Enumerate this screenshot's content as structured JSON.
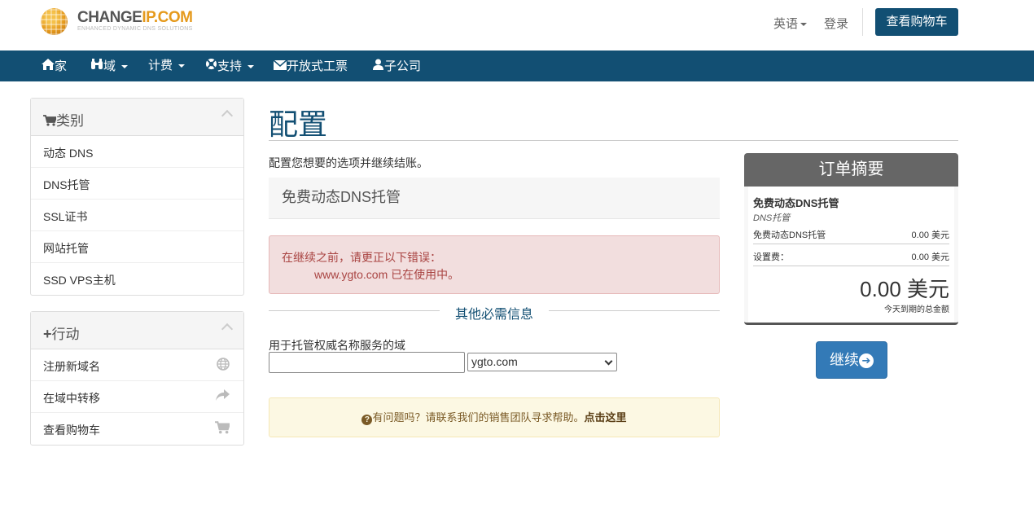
{
  "header": {
    "logo_main": "CHANGE",
    "logo_accent": "IP.COM",
    "logo_tagline": "ENHANCED DYNAMIC DNS SOLUTIONS",
    "language_label": "英语",
    "login_label": "登录",
    "cart_button": "查看购物车"
  },
  "nav": {
    "items": [
      {
        "label": "家",
        "icon": "home-icon"
      },
      {
        "label": "域",
        "icon": "binoculars-icon"
      },
      {
        "label": "计费",
        "icon": ""
      },
      {
        "label": "支持",
        "icon": "lifebuoy-icon"
      },
      {
        "label": "开放式工票",
        "icon": "envelope-icon"
      },
      {
        "label": "子公司",
        "icon": "user-icon"
      }
    ]
  },
  "sidebar": {
    "categories": {
      "title": "类别",
      "items": [
        "动态 DNS",
        "DNS托管",
        "SSL证书",
        "网站托管",
        "SSD VPS主机"
      ]
    },
    "actions": {
      "title": "行动",
      "items": [
        {
          "label": "注册新域名",
          "icon": "globe-icon"
        },
        {
          "label": "在域中转移",
          "icon": "share-icon"
        },
        {
          "label": "查看购物车",
          "icon": "cart-icon"
        }
      ]
    }
  },
  "main": {
    "title": "配置",
    "intro": "配置您想要的选项并继续结账。",
    "product_name": "免费动态DNS托管",
    "error_title": "在继续之前，请更正以下错误：",
    "error_detail": "www.ygto.com 已在使用中。",
    "section_heading": "其他必需信息",
    "field_label": "用于托管权威名称服务的域",
    "field_value": "",
    "select_value": "ygto.com",
    "help_text": "有问题吗？请联系我们的销售团队寻求帮助。",
    "help_link": "点击这里"
  },
  "summary": {
    "title": "订单摘要",
    "product": "免费动态DNS托管",
    "group": "DNS托管",
    "line_item": "免费动态DNS托管",
    "line_price": "0.00 美元",
    "setup_label": "设置费：",
    "setup_price": "0.00 美元",
    "total": "0.00 美元",
    "total_label": "今天到期的总金额",
    "continue_label": "继续"
  },
  "colors": {
    "brand": "#124f73",
    "accent": "#e59a1d",
    "error_bg": "#f2dede",
    "warn_bg": "#fcf8e3",
    "button": "#337ab7"
  }
}
